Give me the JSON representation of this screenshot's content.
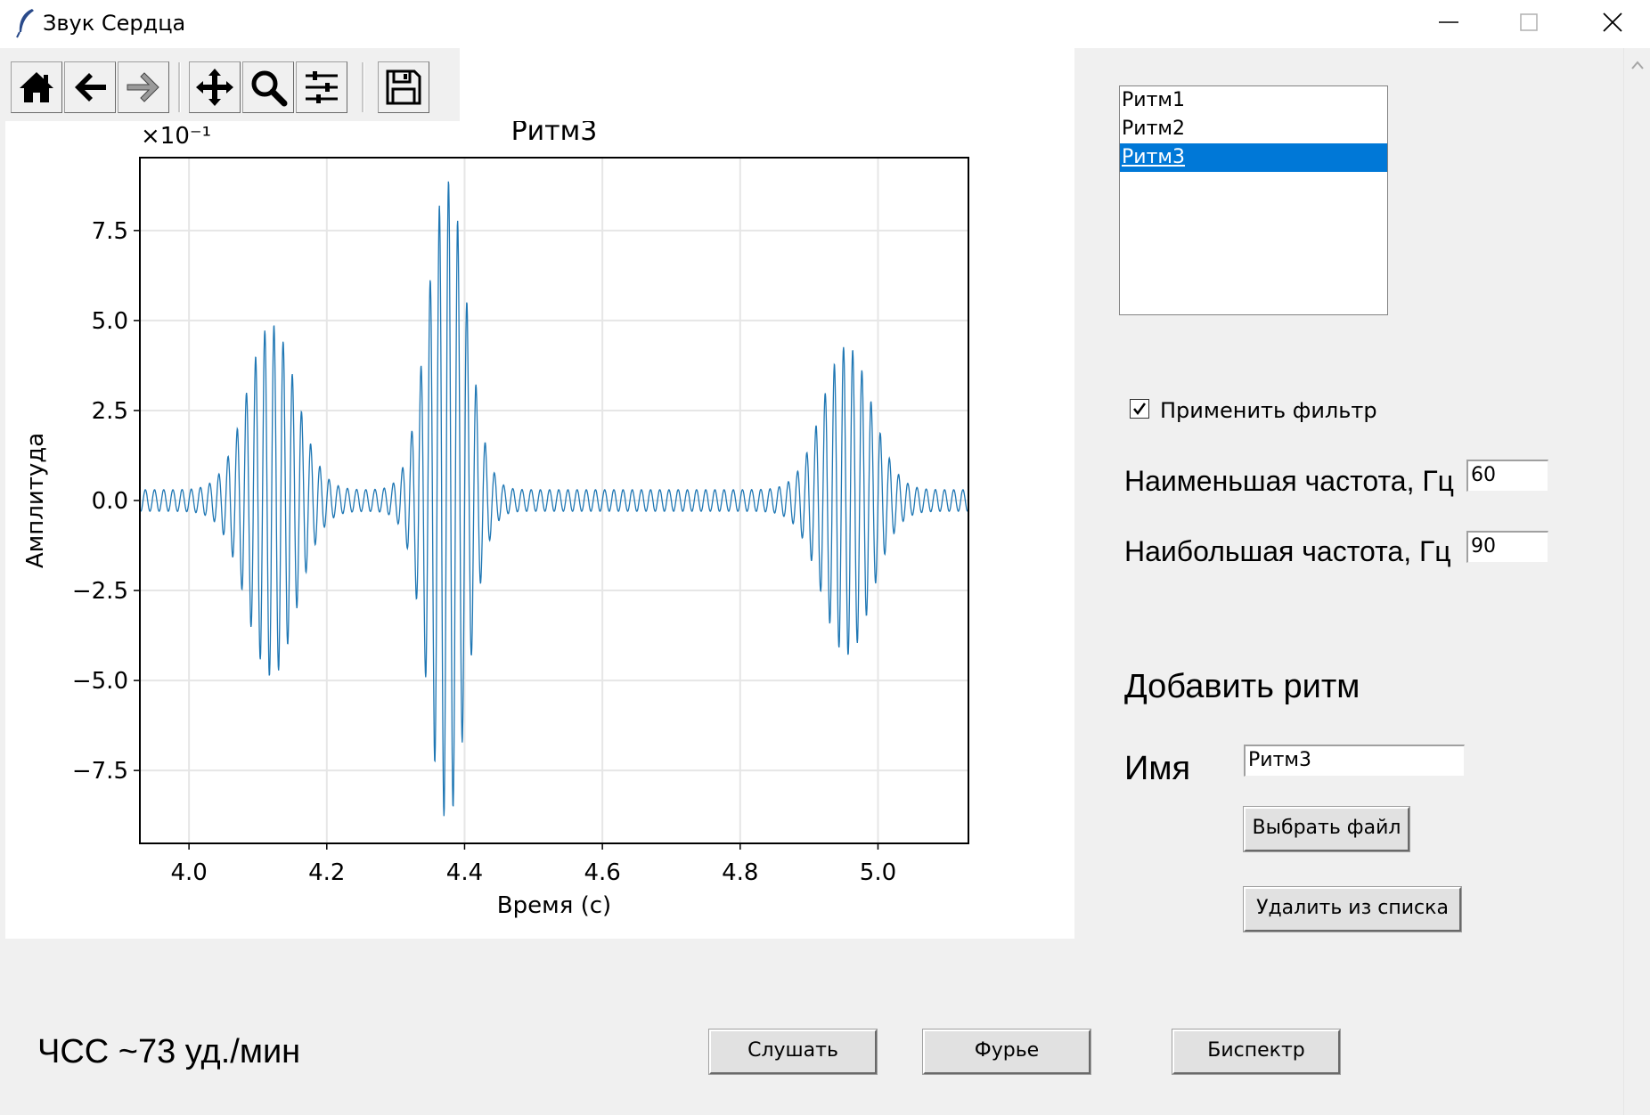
{
  "window": {
    "title": "Звук Сердца"
  },
  "toolbar": {
    "buttons": [
      "home-icon",
      "back-icon",
      "forward-icon",
      "pan-icon",
      "zoom-icon",
      "configure-subplots-icon",
      "save-icon"
    ]
  },
  "chart_data": {
    "type": "line",
    "title": "Ритм3",
    "xlabel": "Время (с)",
    "ylabel": "Амплитуда",
    "offset_label": "×10⁻¹",
    "xlim": [
      3.93,
      5.13
    ],
    "ylim": [
      -9.5,
      9.5
    ],
    "xticks": [
      "4.0",
      "4.2",
      "4.4",
      "4.6",
      "4.8",
      "5.0"
    ],
    "xtick_values": [
      4.0,
      4.2,
      4.4,
      4.6,
      4.8,
      5.0
    ],
    "yticks": [
      "7.5",
      "5.0",
      "2.5",
      "0.0",
      "−2.5",
      "−5.0",
      "−7.5"
    ],
    "ytick_values": [
      7.5,
      5.0,
      2.5,
      0.0,
      -2.5,
      -5.0,
      -7.5
    ],
    "grid": true,
    "line_color": "#1f77b4",
    "signal_model": {
      "carrier_hz": 75,
      "noise_amplitude": 0.3,
      "bursts": [
        {
          "center": 4.12,
          "width": 0.05,
          "amplitude": 4.6
        },
        {
          "center": 4.375,
          "width": 0.04,
          "amplitude": 8.6
        },
        {
          "center": 4.955,
          "width": 0.05,
          "amplitude": 4.0
        }
      ]
    }
  },
  "rhythm_list": {
    "items": [
      "Ритм1",
      "Ритм2",
      "Ритм3"
    ],
    "selected_index": 2
  },
  "filter": {
    "checkbox_label": "Применить фильтр",
    "checked": true,
    "min_freq_label": "Наименьшая частота, Гц",
    "min_freq_value": "60",
    "max_freq_label": "Наибольшая частота, Гц",
    "max_freq_value": "90"
  },
  "add_rhythm": {
    "section_title": "Добавить ритм",
    "name_label": "Имя",
    "name_value": "Ритм3",
    "choose_file_label": "Выбрать файл",
    "remove_label": "Удалить из списка"
  },
  "bottom": {
    "heart_rate_label": "ЧСС ~73 уд./мин",
    "listen_label": "Слушать",
    "fourier_label": "Фурье",
    "bispectrum_label": "Биспектр"
  }
}
